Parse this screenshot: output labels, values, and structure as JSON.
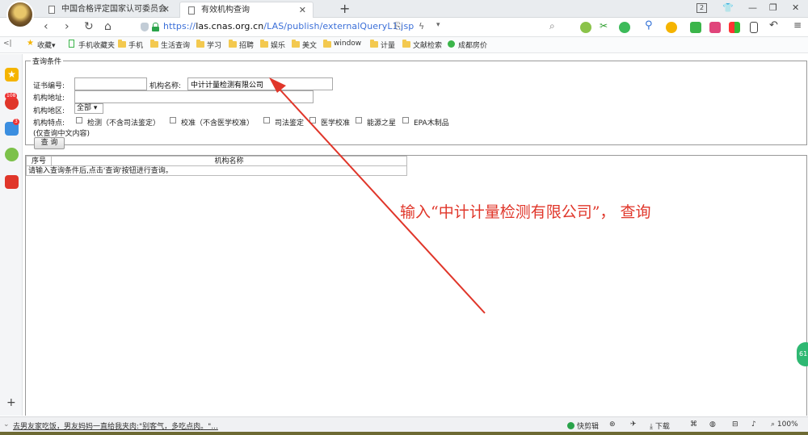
{
  "tabs": [
    {
      "label": "中国合格评定国家认可委员会"
    },
    {
      "label": "有效机构查询"
    }
  ],
  "window": {
    "tab_count": "2"
  },
  "address": {
    "scheme": "https://",
    "host": "las.cnas.org.cn",
    "path": "/LAS/publish/externalQueryL1.jsp"
  },
  "bookmarks": [
    "收藏",
    "手机收藏夹",
    "手机",
    "生活查询",
    "学习",
    "招聘",
    "娱乐",
    "美文",
    "window",
    "计量",
    "文献检索",
    "成都房价"
  ],
  "sidebar": {
    "weibo_badge": "108",
    "mail_badge": "3"
  },
  "query": {
    "legend": "查询条件",
    "cert_label": "证书编号:",
    "cert_value": "",
    "name_label": "机构名称:",
    "name_value": "中计计量检测有限公司",
    "addr_label": "机构地址:",
    "addr_value": "",
    "region_label": "机构地区:",
    "region_value": "全部",
    "features_label": "机构特点:",
    "features": [
      "检测（不含司法鉴定）",
      "校准（不含医学校准）",
      "司法鉴定",
      "医学校准",
      "能源之星",
      "EPA木制品"
    ],
    "note": "(仅查询中文内容)",
    "submit": "查 询"
  },
  "results": {
    "columns": [
      "序号",
      "机构名称"
    ],
    "message": "请输入查询条件后,点击'查询'按钮进行查询。"
  },
  "annotation": "输入“中计计量检测有限公司”， 查询",
  "float_badge": "61",
  "status": {
    "news": "去男友家吃饭，男友妈妈一直给我夹肉:\"别客气，多吃点肉。\"...",
    "clip": "快剪辑",
    "download": "下载",
    "zoom": "100%"
  },
  "colors": {
    "annotation": "#e0362a",
    "link": "#3b6fd8",
    "secure": "#2aa34a"
  }
}
